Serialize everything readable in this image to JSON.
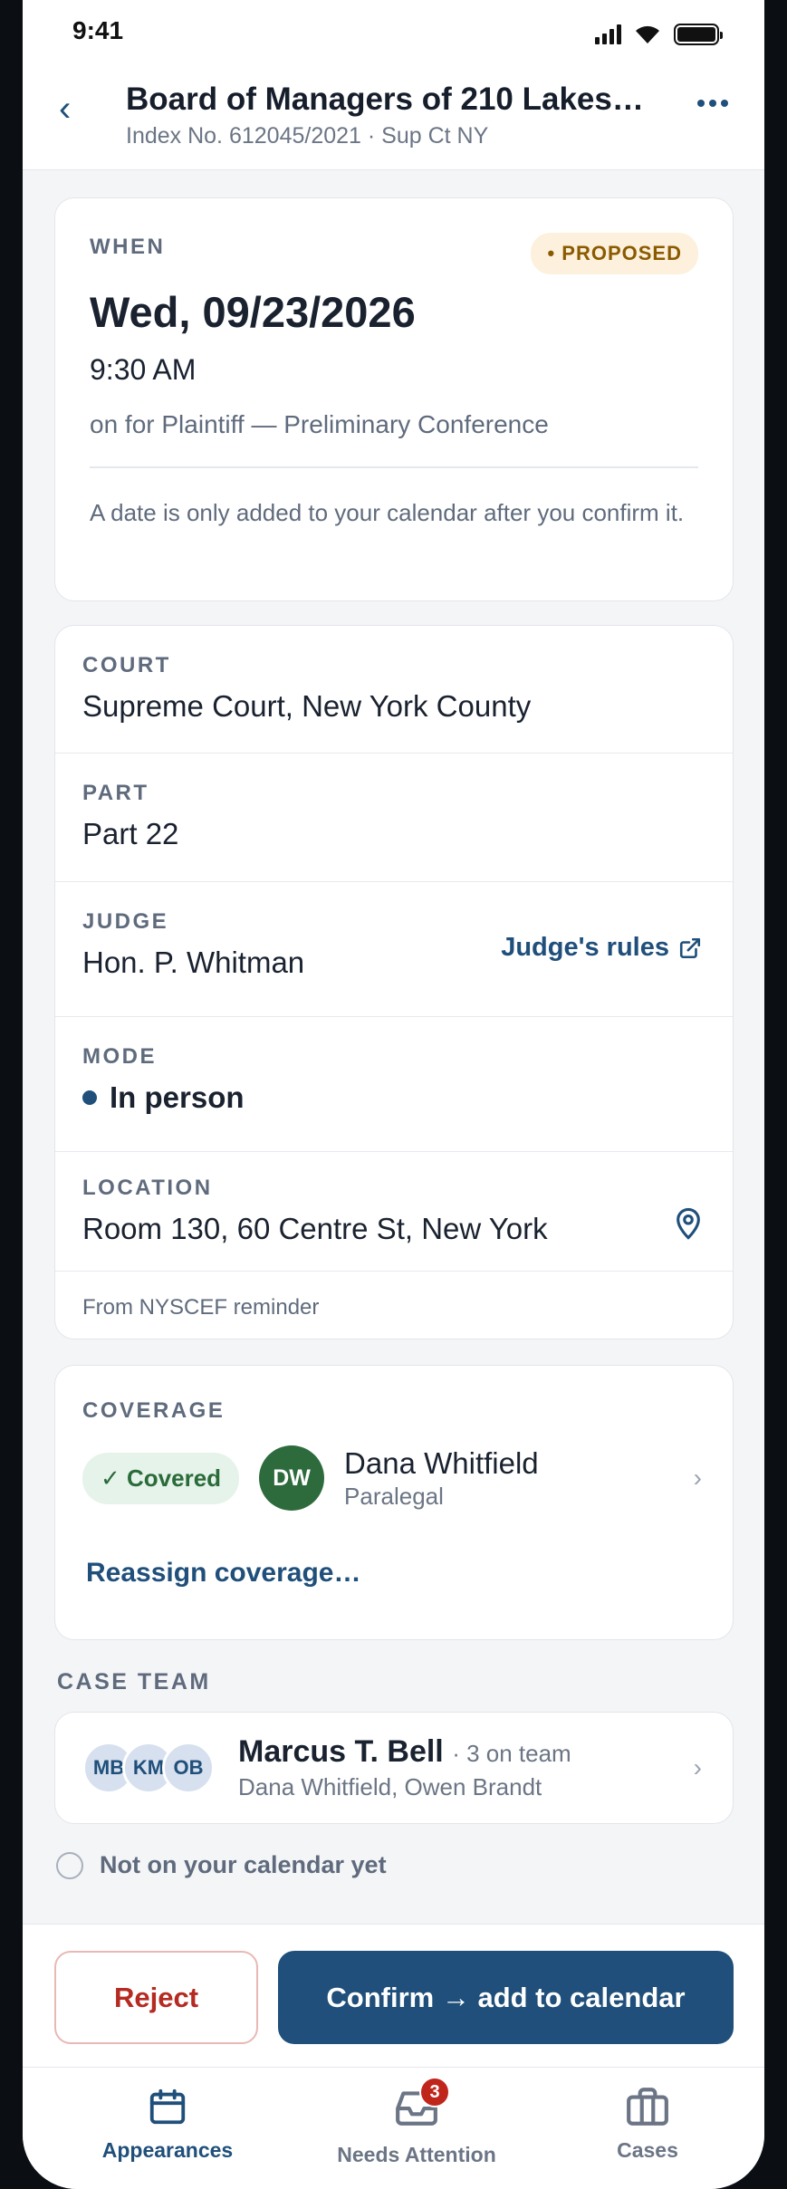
{
  "status_bar": {
    "time": "9:41"
  },
  "header": {
    "back_icon": "chevron-left-icon",
    "title": "Board of Managers of 210 Lakes…",
    "subtitle": "Index No. 612045/2021 · Sup Ct NY",
    "more_icon": "more-horizontal-icon"
  },
  "when": {
    "label": "WHEN",
    "badge": "• PROPOSED",
    "date": "Wed, 09/23/2026",
    "time": "9:30 AM",
    "event": "on for Plaintiff — Preliminary Conference",
    "note": "A date is only added to your calendar after you confirm it."
  },
  "details": {
    "court_label": "COURT",
    "court_value": "Supreme Court, New York County",
    "part_label": "PART",
    "part_value": "Part 22",
    "judge_label": "JUDGE",
    "judge_value": "Hon. P. Whitman",
    "judge_rules_link": "Judge's rules",
    "mode_label": "MODE",
    "mode_value": "In person",
    "location_label": "LOCATION",
    "location_value": "Room 130, 60 Centre St, New York",
    "source": "From NYSCEF reminder"
  },
  "coverage": {
    "label": "COVERAGE",
    "status": "✓ Covered",
    "avatar_initials": "DW",
    "name": "Dana Whitfield",
    "role": "Paralegal",
    "reassign": "Reassign coverage…"
  },
  "case_team": {
    "label": "CASE TEAM",
    "avatars": [
      "MB",
      "KM",
      "OB"
    ],
    "lead": "Marcus T. Bell",
    "count": "· 3 on team",
    "members": "Dana Whitfield, Owen Brandt"
  },
  "calendar_status": "Not on your calendar yet",
  "actions": {
    "reject": "Reject",
    "confirm": "Confirm → add to calendar"
  },
  "tabs": [
    {
      "label": "Appearances",
      "icon": "calendar-icon",
      "active": true
    },
    {
      "label": "Needs Attention",
      "icon": "inbox-icon",
      "badge": "3"
    },
    {
      "label": "Cases",
      "icon": "briefcase-icon"
    }
  ],
  "colors": {
    "accent": "#1f4f7a",
    "reject": "#b52a22",
    "covered_bg": "#e6f3ea",
    "proposed_bg": "#fdf0dc",
    "badge_red": "#c0251c"
  }
}
